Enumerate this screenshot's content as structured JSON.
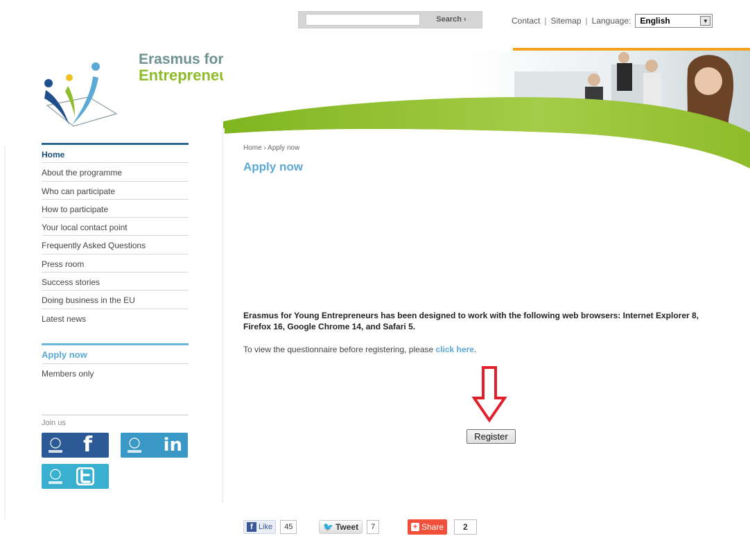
{
  "search": {
    "placeholder": "",
    "button_label": "Search ›"
  },
  "top_links": {
    "contact": "Contact",
    "sitemap": "Sitemap",
    "separator": "|",
    "language_label": "Language:",
    "language_value": "English"
  },
  "logo": {
    "line1": "Erasmus for Young",
    "line2": "Entrepreneurs"
  },
  "nav": {
    "items": [
      {
        "label": "Home"
      },
      {
        "label": "About the programme"
      },
      {
        "label": "Who can participate"
      },
      {
        "label": "How to participate"
      },
      {
        "label": "Your local contact point"
      },
      {
        "label": "Frequently Asked Questions"
      },
      {
        "label": "Press room"
      },
      {
        "label": "Success stories"
      },
      {
        "label": "Doing business in the EU"
      },
      {
        "label": "Latest news"
      }
    ],
    "apply_now": "Apply now",
    "members_only": "Members only",
    "join_us": "Join us"
  },
  "social": {
    "facebook": "f",
    "linkedin": "in",
    "twitter": "t"
  },
  "content": {
    "breadcrumb_home": "Home",
    "breadcrumb_sep": "›",
    "breadcrumb_current": "Apply now",
    "title": "Apply now",
    "browser_note": "Erasmus for Young Entrepreneurs has been designed to work with the following web browsers: Internet Explorer 8, Firefox 16, Google Chrome 14, and Safari 5.",
    "questionnaire_prefix": "To view the questionnaire before registering, please ",
    "questionnaire_link": "click here",
    "questionnaire_suffix": ".",
    "register_label": "Register"
  },
  "share_bar": {
    "like_label": "Like",
    "like_count": "45",
    "tweet_label": "Tweet",
    "tweet_count": "7",
    "share_label": "Share",
    "share_count": "2"
  },
  "colors": {
    "brand_green": "#8ebc2a",
    "brand_teal": "#6e9292",
    "accent_blue": "#5ba9d4",
    "nav_border": "#2a6a92",
    "arrow_red": "#e0202a"
  }
}
